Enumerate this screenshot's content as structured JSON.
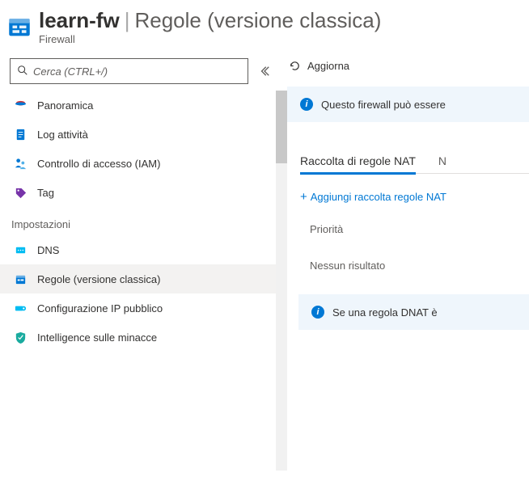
{
  "header": {
    "resource_name": "learn-fw",
    "separator": "|",
    "page_title": "Regole (versione classica)",
    "resource_type": "Firewall"
  },
  "search": {
    "placeholder": "Cerca (CTRL+/)"
  },
  "nav": {
    "overview": "Panoramica",
    "activity_log": "Log attività",
    "access_control": "Controllo di accesso (IAM)",
    "tags": "Tag",
    "section_settings": "Impostazioni",
    "dns": "DNS",
    "rules_classic": "Regole (versione classica)",
    "public_ip": "Configurazione IP pubblico",
    "threat_intel": "Intelligence sulle minacce"
  },
  "right": {
    "refresh": "Aggiorna",
    "info_top": "Questo firewall può essere",
    "tab_nat": "Raccolta di regole NAT",
    "tab_next": "N",
    "add_nat": "Aggiungi raccolta regole NAT",
    "col_priority": "Priorità",
    "no_results": "Nessun risultato",
    "info_bottom": "Se una regola DNAT è"
  }
}
